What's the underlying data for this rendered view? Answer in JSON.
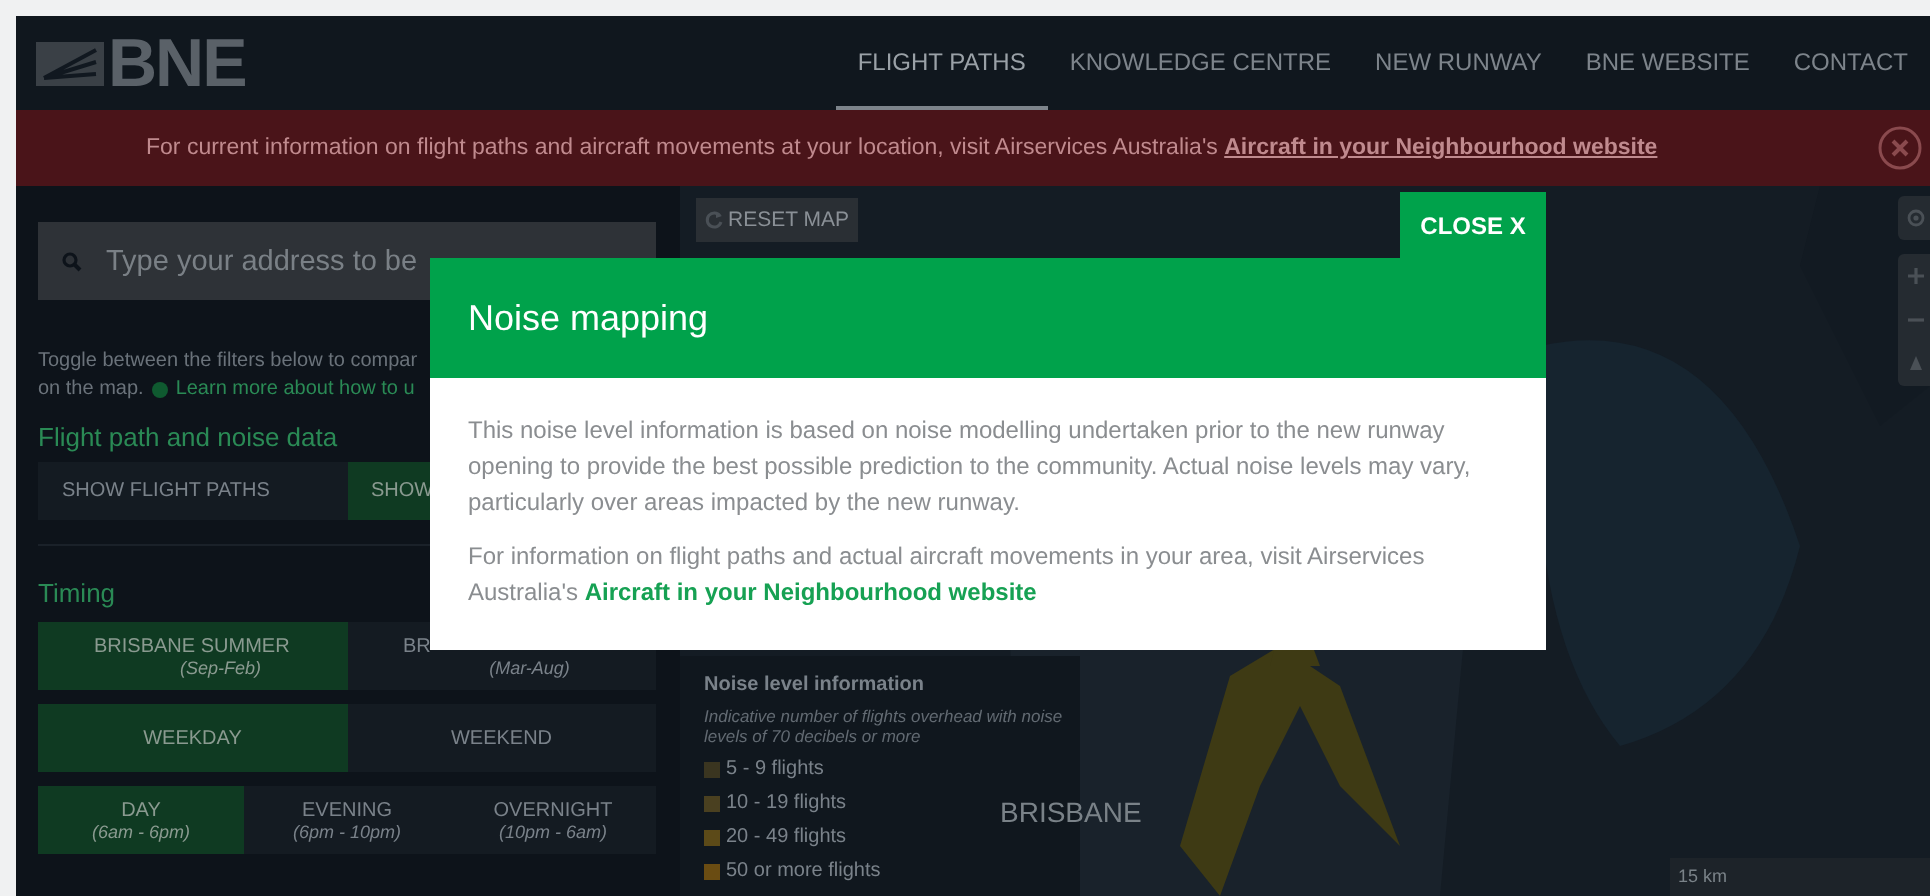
{
  "header": {
    "logo": "BNE",
    "nav": [
      {
        "label": "FLIGHT PATHS",
        "selected": true
      },
      {
        "label": "KNOWLEDGE CENTRE",
        "selected": false
      },
      {
        "label": "NEW RUNWAY",
        "selected": false
      },
      {
        "label": "BNE WEBSITE",
        "selected": false
      },
      {
        "label": "CONTACT",
        "selected": false
      }
    ]
  },
  "banner": {
    "text": "For current information on flight paths and aircraft movements at your location, visit Airservices Australia's",
    "link": "Aircraft in your Neighbourhood website"
  },
  "sidebar": {
    "search": {
      "placeholder": "Type your address to be"
    },
    "intro": "Toggle between the filters below to compar",
    "intro_2": "on the map.",
    "learn_more": "Learn more about how to u",
    "filter_heading": "Flight path and noise data",
    "filters": [
      {
        "label": "SHOW FLIGHT PATHS",
        "selected": false
      },
      {
        "label": "SHOW",
        "selected": true
      }
    ],
    "timing_heading": "Timing",
    "timing_rows": [
      [
        {
          "label": "BRISBANE SUMMER",
          "sub": "(Sep-Feb)",
          "selected": true
        },
        {
          "label": "BR",
          "sub": "(Mar-Aug)",
          "selected": false
        }
      ],
      [
        {
          "label": "WEEKDAY",
          "selected": true
        },
        {
          "label": "WEEKEND",
          "selected": false
        }
      ],
      [
        {
          "label": "DAY",
          "sub": "(6am - 6pm)",
          "selected": true
        },
        {
          "label": "EVENING",
          "sub": "(6pm - 10pm)",
          "selected": false
        },
        {
          "label": "OVERNIGHT",
          "sub": "(10pm - 6am)",
          "selected": false
        }
      ]
    ]
  },
  "map": {
    "reset": "RESET MAP",
    "legend": {
      "title": "Noise level information",
      "note": "Indicative number of flights overhead with noise levels of 70 decibels or more",
      "items": [
        {
          "label": "5 - 9 flights",
          "color": "#3a3520"
        },
        {
          "label": "10 - 19 flights",
          "color": "#4a4020"
        },
        {
          "label": "20 - 49 flights",
          "color": "#5c4a18"
        },
        {
          "label": "50 or more flights",
          "color": "#6a4c12"
        }
      ]
    },
    "place_label": "BRISBANE",
    "scale": "15 km"
  },
  "modal": {
    "close": "CLOSE X",
    "title": "Noise mapping",
    "paragraph": "This noise level information is based on noise modelling undertaken prior to the new runway opening to provide the best possible prediction to the community. Actual noise levels may vary, particularly over areas impacted by the new runway.",
    "paragraph_2": "For information on flight paths and actual aircraft movements in your area, visit Airservices Australia's",
    "link": "Aircraft in your Neighbourhood website"
  }
}
